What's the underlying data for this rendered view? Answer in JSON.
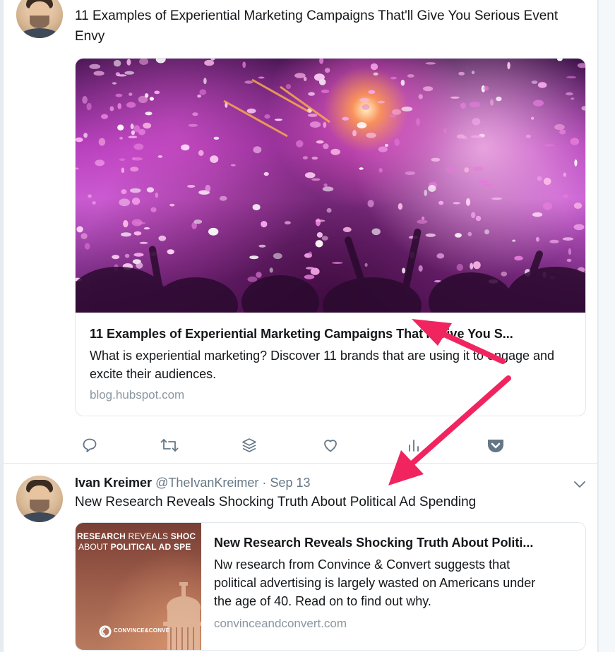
{
  "tweet1": {
    "text": "11 Examples of Experiential Marketing Campaigns That'll Give You Serious Event Envy",
    "card": {
      "title": "11 Examples of Experiential Marketing Campaigns That'll Give You S...",
      "description": "What is experiential marketing? Discover 11 brands that are using it to engage and excite their audiences.",
      "url": "blog.hubspot.com",
      "image_icon": "concert-confetti-photo"
    },
    "actions": [
      {
        "name": "reply",
        "icon": "reply-icon"
      },
      {
        "name": "retweet",
        "icon": "retweet-icon"
      },
      {
        "name": "buffer",
        "icon": "buffer-stack-icon"
      },
      {
        "name": "like",
        "icon": "heart-icon"
      },
      {
        "name": "analytics",
        "icon": "analytics-icon"
      },
      {
        "name": "pocket",
        "icon": "pocket-icon"
      }
    ]
  },
  "tweet2": {
    "author_name": "Ivan Kreimer",
    "handle": "@TheIvanKreimer",
    "separator": "·",
    "date": "Sep 13",
    "text": "New Research Reveals Shocking Truth About Political Ad Spending",
    "card": {
      "title": "New Research Reveals Shocking Truth About Politi...",
      "description": "Nw research from Convince & Convert suggests that political advertising is largely wasted on Americans under the age of 40. Read on to find out why.",
      "url": "convinceandconvert.com",
      "image_caption_line1_a": "RESEARCH",
      "image_caption_line1_b": " REVEALS ",
      "image_caption_line1_c": "SHOC",
      "image_caption_line2_a": "ABOUT ",
      "image_caption_line2_b": "POLITICAL AD SPE",
      "image_logo_text": "CONVINCE&CONVE"
    }
  },
  "colors": {
    "annotation_arrow": "#f0255f",
    "icon_gray": "#657786",
    "link_gray": "#8a969f"
  }
}
